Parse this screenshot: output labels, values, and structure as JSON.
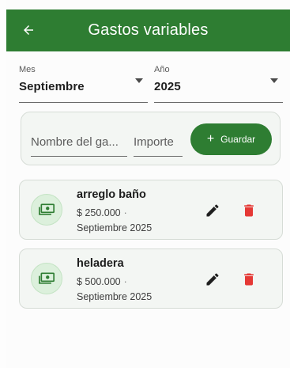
{
  "appbar": {
    "title": "Gastos variables",
    "back_icon": "arrow-left-icon",
    "color": "#2e7d32"
  },
  "filters": {
    "month": {
      "label": "Mes",
      "value": "Septiembre"
    },
    "year": {
      "label": "Año",
      "value": "2025"
    }
  },
  "form": {
    "name_placeholder": "Nombre del ga...",
    "amount_placeholder": "Importe",
    "save_label": "Guardar",
    "save_icon": "plus-icon"
  },
  "expenses": [
    {
      "name": "arreglo baño",
      "amount": "$ 250.000",
      "separator": "·",
      "period": "Septiembre 2025",
      "icon": "money-icon"
    },
    {
      "name": "heladera",
      "amount": "$ 500.000",
      "separator": "·",
      "period": "Septiembre 2025",
      "icon": "money-icon"
    }
  ],
  "colors": {
    "primary": "#2e7d32",
    "edit": "#1f1f1f",
    "delete": "#e53935",
    "avatar_bg": "#dcf0dc"
  }
}
